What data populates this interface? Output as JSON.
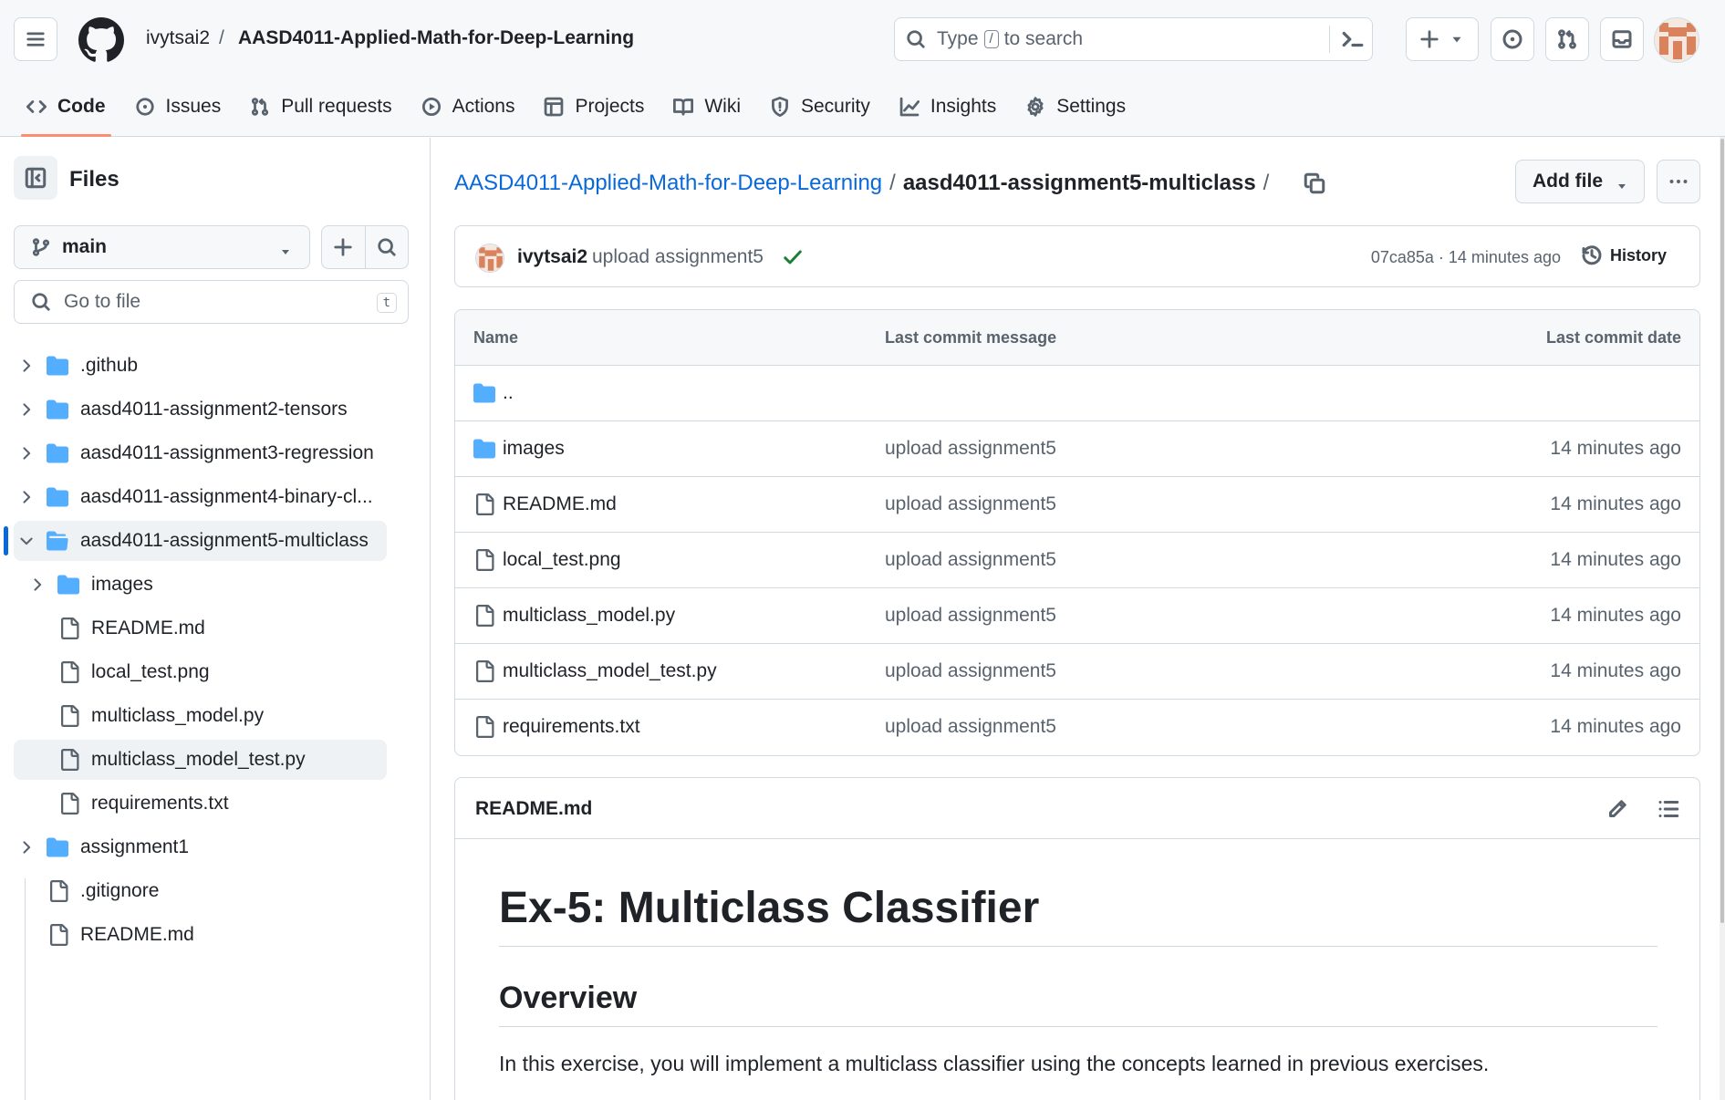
{
  "header": {
    "owner": "ivytsai2",
    "separator": "/",
    "repo": "AASD4011-Applied-Math-for-Deep-Learning",
    "search_prefix": "Type",
    "search_key": "/",
    "search_suffix": "to search"
  },
  "nav": {
    "tabs": [
      {
        "label": "Code",
        "icon": "code-icon",
        "active": true
      },
      {
        "label": "Issues",
        "icon": "issue-opened-icon"
      },
      {
        "label": "Pull requests",
        "icon": "git-pull-request-icon"
      },
      {
        "label": "Actions",
        "icon": "play-icon"
      },
      {
        "label": "Projects",
        "icon": "table-icon"
      },
      {
        "label": "Wiki",
        "icon": "book-icon"
      },
      {
        "label": "Security",
        "icon": "shield-icon"
      },
      {
        "label": "Insights",
        "icon": "graph-icon"
      },
      {
        "label": "Settings",
        "icon": "gear-icon"
      }
    ]
  },
  "sidebar": {
    "title": "Files",
    "branch": "main",
    "goto_placeholder": "Go to file",
    "goto_key": "t",
    "tree": [
      {
        "label": ".github",
        "type": "folder"
      },
      {
        "label": "aasd4011-assignment2-tensors",
        "type": "folder"
      },
      {
        "label": "aasd4011-assignment3-regression",
        "type": "folder"
      },
      {
        "label": "aasd4011-assignment4-binary-cl...",
        "type": "folder"
      },
      {
        "label": "aasd4011-assignment5-multiclass",
        "type": "folder-open"
      },
      {
        "label": "images",
        "type": "folder"
      },
      {
        "label": "README.md",
        "type": "file"
      },
      {
        "label": "local_test.png",
        "type": "file"
      },
      {
        "label": "multiclass_model.py",
        "type": "file"
      },
      {
        "label": "multiclass_model_test.py",
        "type": "file"
      },
      {
        "label": "requirements.txt",
        "type": "file"
      },
      {
        "label": "assignment1",
        "type": "folder"
      },
      {
        "label": ".gitignore",
        "type": "file"
      },
      {
        "label": "README.md",
        "type": "file"
      }
    ]
  },
  "main": {
    "path_root": "AASD4011-Applied-Math-for-Deep-Learning",
    "path_sep": "/",
    "path_dir": "aasd4011-assignment5-multiclass",
    "add_file_label": "Add file",
    "commit": {
      "author": "ivytsai2",
      "message": "upload assignment5",
      "meta": "07ca85a · 14 minutes ago",
      "history_label": "History"
    },
    "table": {
      "col_name": "Name",
      "col_message": "Last commit message",
      "col_date": "Last commit date",
      "parent_dir": "..",
      "rows": [
        {
          "name": "images",
          "type": "folder",
          "message": "upload assignment5",
          "date": "14 minutes ago"
        },
        {
          "name": "README.md",
          "type": "file",
          "message": "upload assignment5",
          "date": "14 minutes ago"
        },
        {
          "name": "local_test.png",
          "type": "file",
          "message": "upload assignment5",
          "date": "14 minutes ago"
        },
        {
          "name": "multiclass_model.py",
          "type": "file",
          "message": "upload assignment5",
          "date": "14 minutes ago"
        },
        {
          "name": "multiclass_model_test.py",
          "type": "file",
          "message": "upload assignment5",
          "date": "14 minutes ago"
        },
        {
          "name": "requirements.txt",
          "type": "file",
          "message": "upload assignment5",
          "date": "14 minutes ago"
        }
      ]
    },
    "readme": {
      "title": "README.md",
      "h1": "Ex-5: Multiclass Classifier",
      "h2": "Overview",
      "p": "In this exercise, you will implement a multiclass classifier using the concepts learned in previous exercises."
    }
  },
  "colors": {
    "accent": "#0969da",
    "folder": "#54aeff",
    "success": "#1a7f37",
    "tab_underline": "#fd8c73"
  }
}
